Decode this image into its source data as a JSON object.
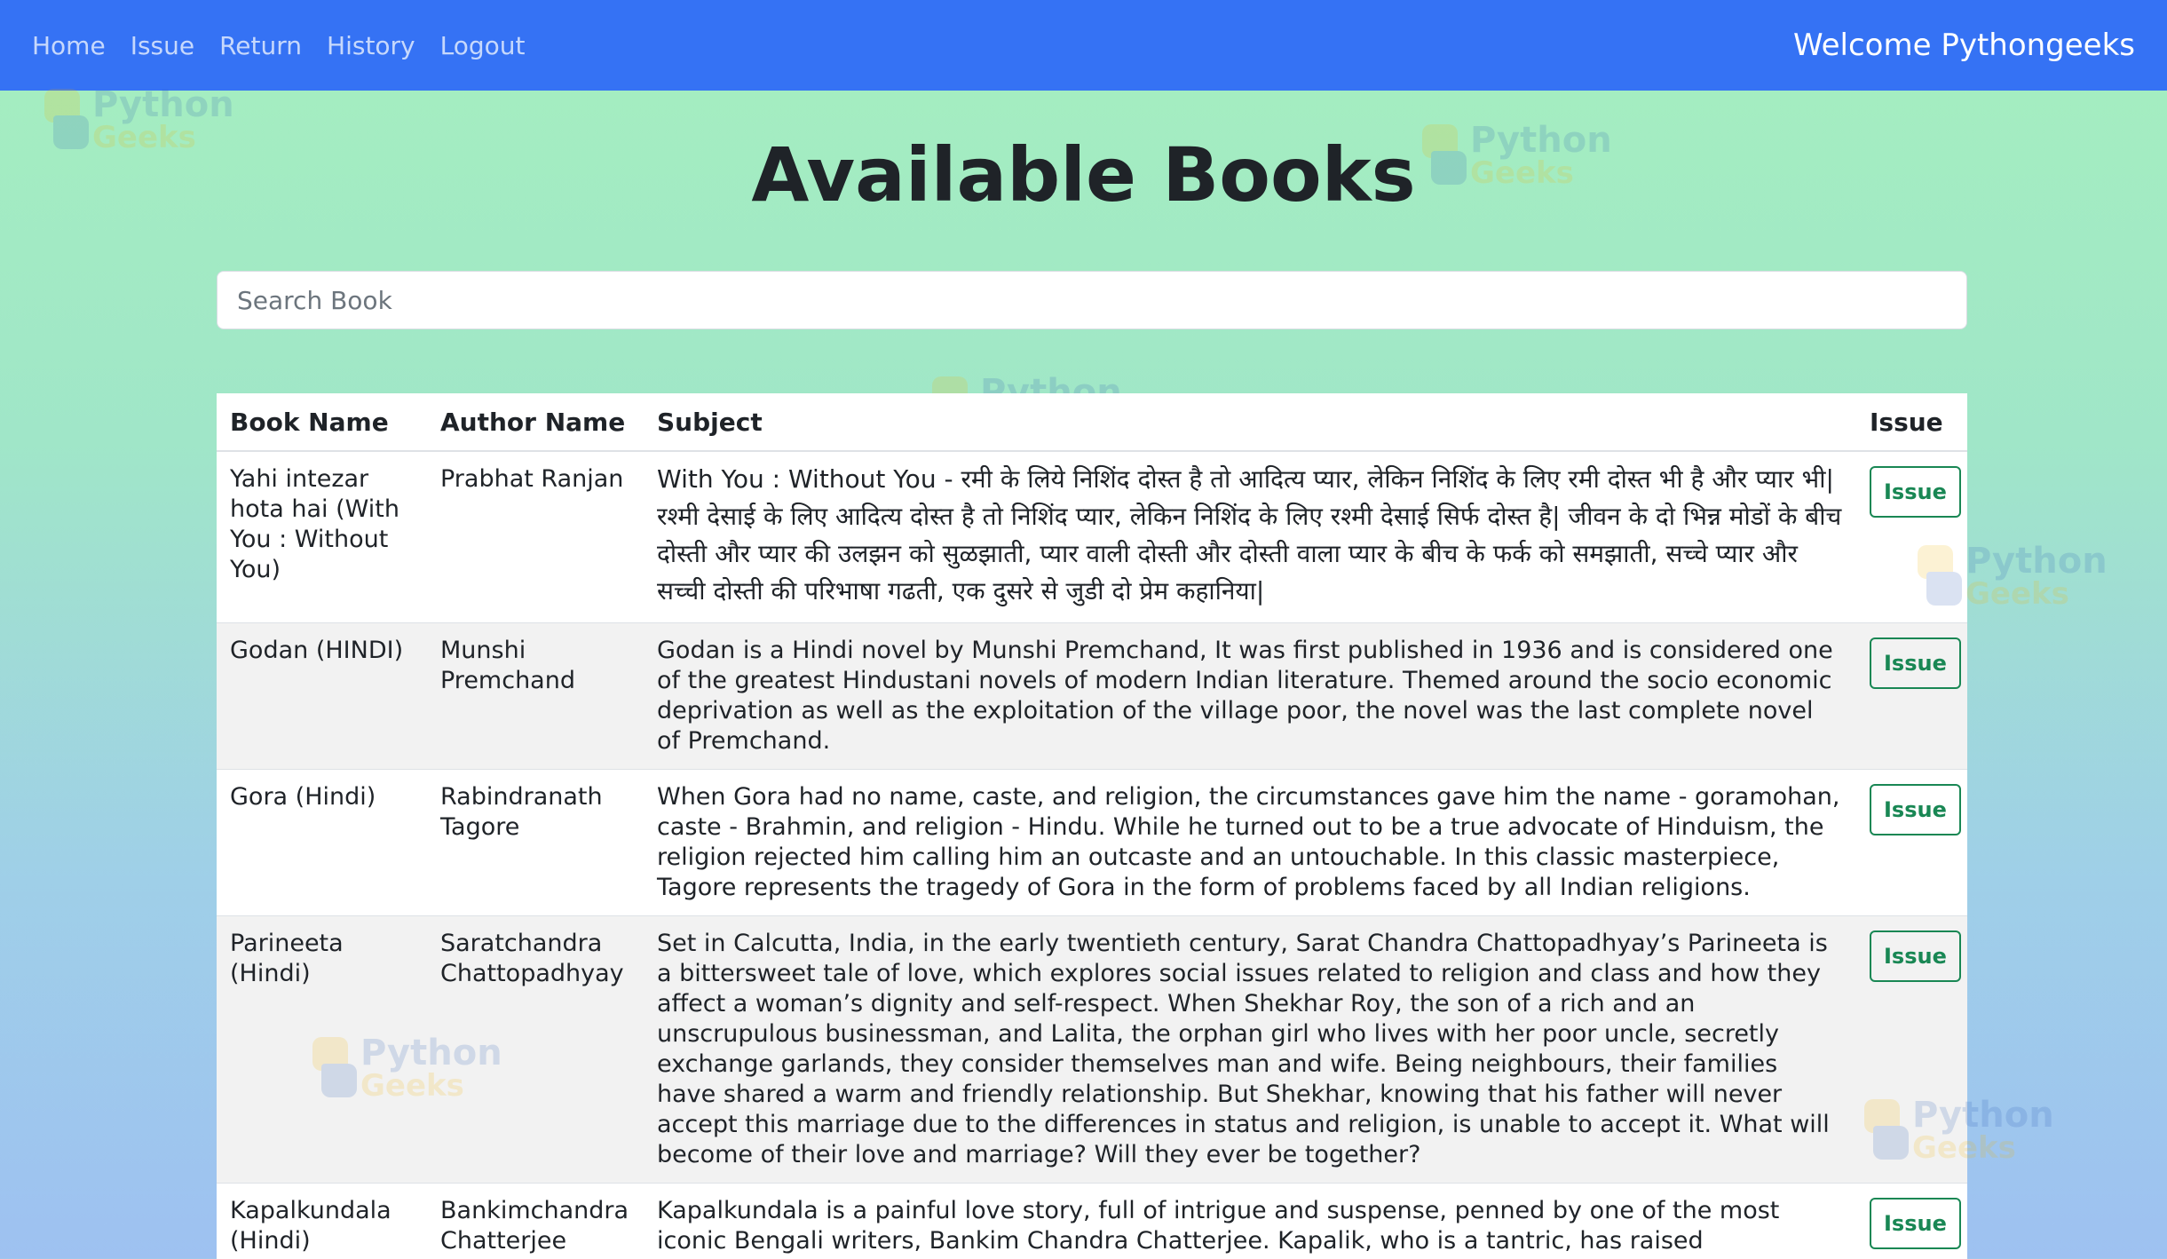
{
  "nav": {
    "links": [
      "Home",
      "Issue",
      "Return",
      "History",
      "Logout"
    ],
    "welcome": "Welcome Pythongeeks"
  },
  "watermark": {
    "line1": "Python",
    "line2": "Geeks"
  },
  "page": {
    "title": "Available Books"
  },
  "search": {
    "placeholder": "Search Book",
    "value": ""
  },
  "table": {
    "headers": [
      "Book Name",
      "Author Name",
      "Subject",
      "Issue"
    ],
    "rows": [
      {
        "book": "Yahi intezar hota hai (With You : Without You)",
        "author": "Prabhat Ranjan",
        "subject": "With You : Without You - रमी के लिये निशिंद दोस्त है तो आदित्य प्यार, लेकिन निशिंद के लिए रमी दोस्त भी है और प्यार भी| रश्मी देसाई के लिए आदित्य दोस्त है तो निशिंद प्यार, लेकिन निशिंद के लिए रश्मी देसाई सिर्फ दोस्त है| जीवन के दो भिन्न मोडों के बीच दोस्ती और प्यार की उलझन को सुळझाती, प्यार वाली दोस्ती और दोस्ती वाला प्यार के बीच के फर्क को समझाती, सच्चे प्यार और सच्ची दोस्ती की परिभाषा गढती, एक दुसरे से जुडी दो प्रेम कहानिया|",
        "action": "Issue"
      },
      {
        "book": "Godan (HINDI)",
        "author": "Munshi Premchand",
        "subject": "Godan is a Hindi novel by Munshi Premchand, It was first published in 1936 and is considered one of the greatest Hindustani novels of modern Indian literature. Themed around the socio economic deprivation as well as the exploitation of the village poor, the novel was the last complete novel of Premchand.",
        "action": "Issue"
      },
      {
        "book": "Gora (Hindi)",
        "author": "Rabindranath Tagore",
        "subject": "When Gora had no name, caste, and religion, the circumstances gave him the name - goramohan, caste - Brahmin, and religion - Hindu. While he turned out to be a true advocate of Hinduism, the religion rejected him calling him an outcaste and an untouchable. In this classic masterpiece, Tagore represents the tragedy of Gora in the form of problems faced by all Indian religions.",
        "action": "Issue"
      },
      {
        "book": "Parineeta (Hindi)",
        "author": "Saratchandra Chattopadhyay",
        "subject": "Set in Calcutta, India, in the early twentieth century, Sarat Chandra Chattopadhyay’s Parineeta is a bittersweet tale of love, which explores social issues related to religion and class and how they affect a woman’s dignity and self-respect. When Shekhar Roy, the son of a rich and an unscrupulous businessman, and Lalita, the orphan girl who lives with her poor uncle, secretly exchange garlands, they consider themselves man and wife. Being neighbours, their families have shared a warm and friendly relationship. But Shekhar, knowing that his father will never accept this marriage due to the differences in status and religion, is unable to accept it. What will become of their love and marriage? Will they ever be together?",
        "action": "Issue"
      },
      {
        "book": "Kapalkundala (Hindi)",
        "author": "Bankimchandra Chatterjee",
        "subject": "Kapalkundala is a painful love story, full of intrigue and suspense, penned by one of the most iconic Bengali writers, Bankim Chandra Chatterjee. Kapalik, who is a tantric, has raised kapalkundala like the",
        "action": "Issue"
      }
    ]
  }
}
